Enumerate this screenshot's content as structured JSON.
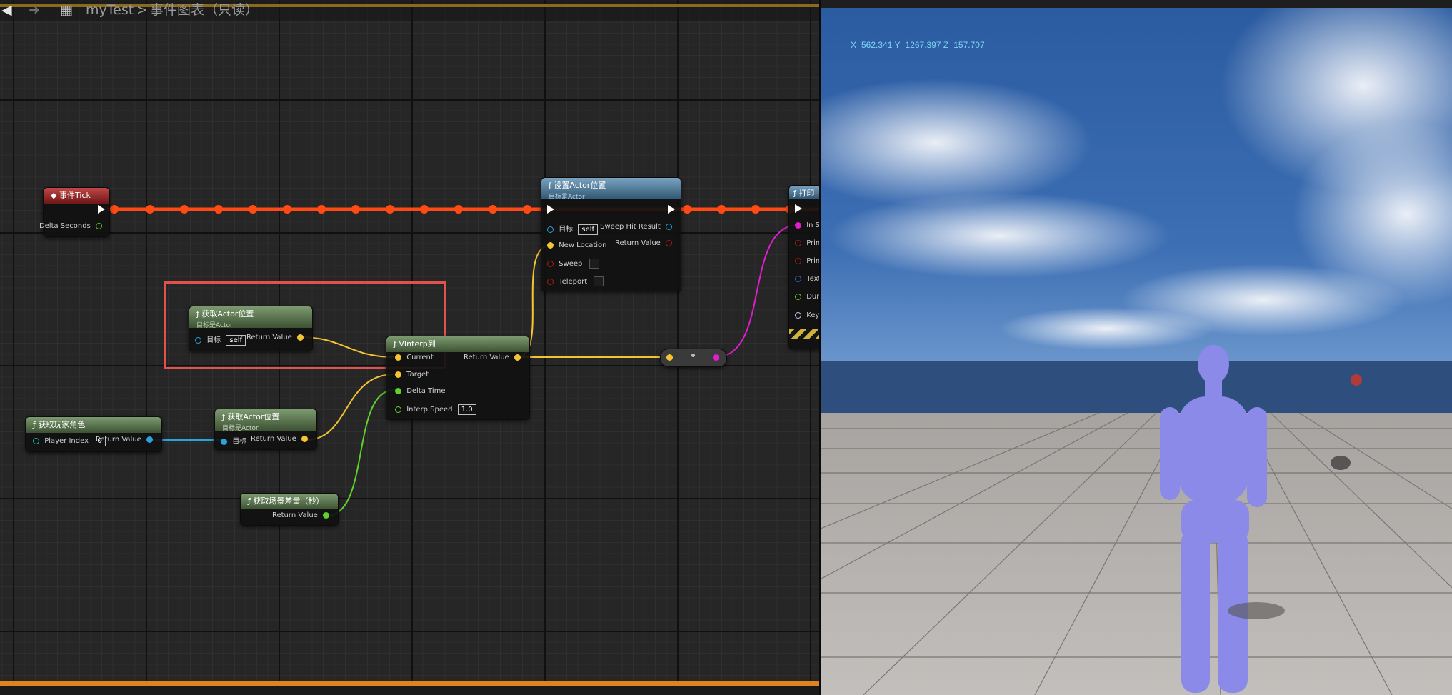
{
  "breadcrumb": {
    "project": "myTest",
    "separator": ">",
    "graph": "事件图表",
    "readonly": "（只读）"
  },
  "nodes": {
    "event_tick": {
      "title": "事件Tick",
      "pin_delta": "Delta Seconds"
    },
    "set_actor_location": {
      "title": "设置Actor位置",
      "subtitle": "目标是Actor",
      "pin_target": "目标",
      "target_value": "self",
      "pin_new_location": "New Location",
      "pin_sweep": "Sweep",
      "pin_teleport": "Teleport",
      "pin_sweep_hit": "Sweep Hit Result",
      "pin_return": "Return Value"
    },
    "get_actor_location_1": {
      "title": "获取Actor位置",
      "subtitle": "目标是Actor",
      "pin_target": "目标",
      "target_value": "self",
      "pin_return": "Return Value"
    },
    "vinterp_to": {
      "title": "VInterp到",
      "pin_current": "Current",
      "pin_target": "Target",
      "pin_delta_time": "Delta Time",
      "pin_interp_speed": "Interp Speed",
      "interp_speed_value": "1.0",
      "pin_return": "Return Value"
    },
    "get_player_character": {
      "title": "获取玩家角色",
      "pin_player_index": "Player Index",
      "player_index_value": "0",
      "pin_return": "Return Value"
    },
    "get_actor_location_2": {
      "title": "获取Actor位置",
      "subtitle": "目标是Actor",
      "pin_target": "目标",
      "pin_return": "Return Value"
    },
    "get_world_delta": {
      "title": "获取场景差量（秒）",
      "pin_return": "Return Value"
    },
    "print_string": {
      "title": "打印",
      "pins": [
        "In S",
        "Prin",
        "Prin",
        "Text",
        "Dura",
        "Key"
      ]
    }
  },
  "viewport": {
    "coords": "X=562.341 Y=1267.397 Z=157.707"
  },
  "colors": {
    "exec_wire": "#ff4a14",
    "vector_wire": "#f4c431",
    "float_wire": "#5fd12c",
    "object_wire": "#2ba3e0",
    "string_wire": "#e11ecd",
    "selection": "#e2514b"
  }
}
